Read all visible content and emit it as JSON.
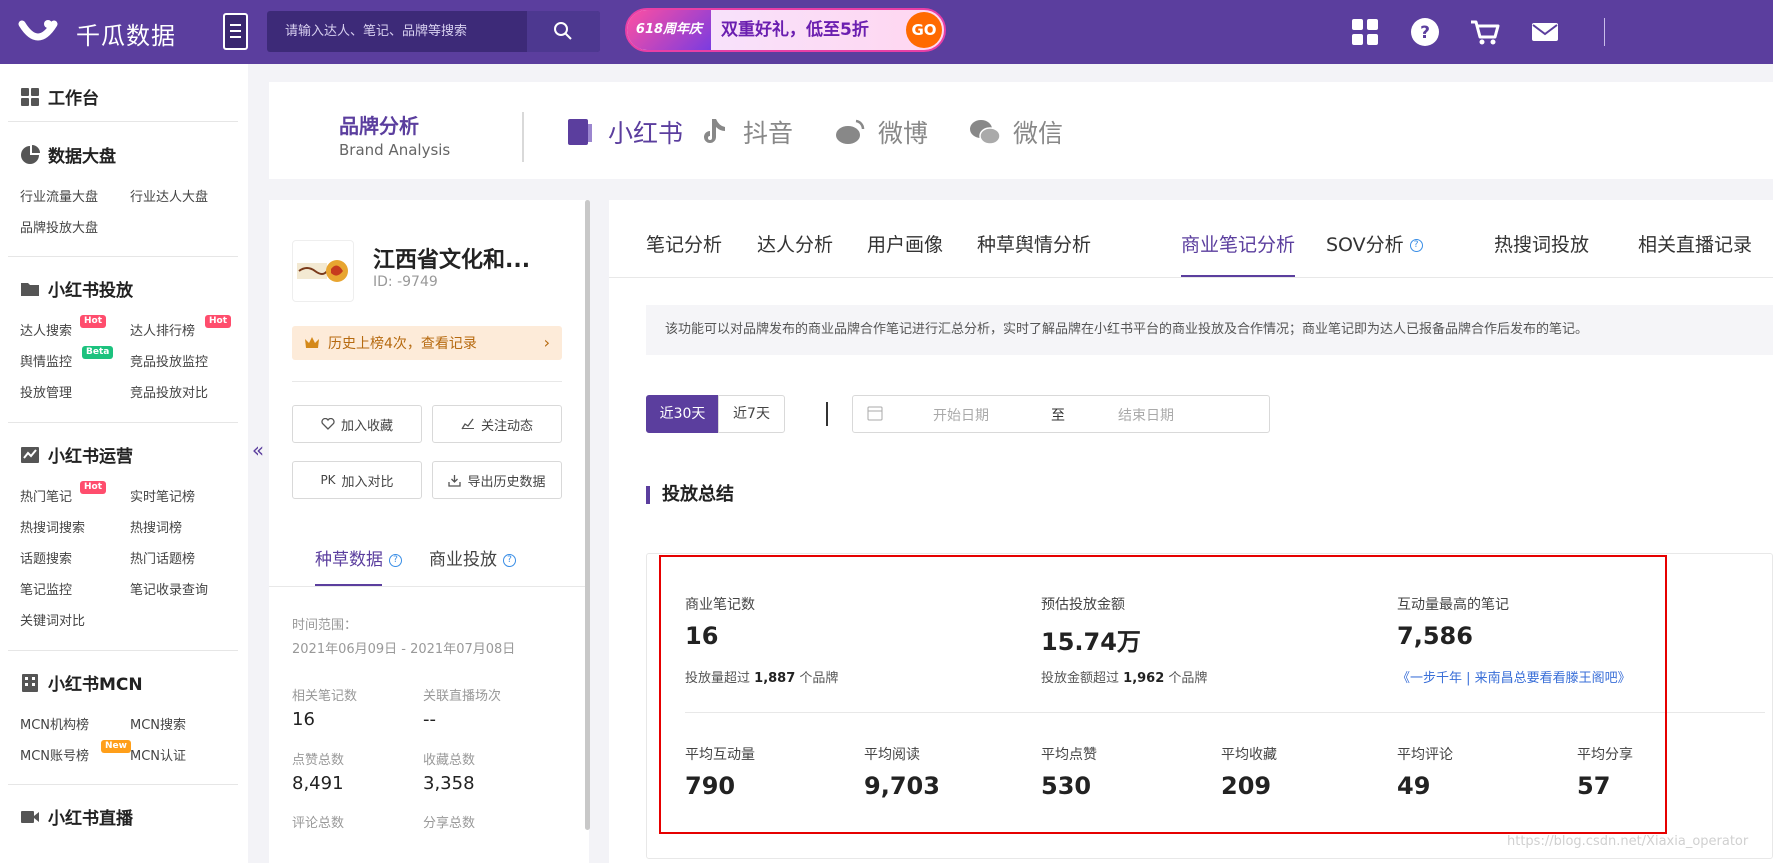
{
  "header": {
    "logo_text": "千瓜数据",
    "search_placeholder": "请输入达人、笔记、品牌等搜索",
    "promo": {
      "tag": "618周年庆",
      "text": "双重好礼，低至5折",
      "go": "GO"
    },
    "icons": [
      "grid-icon",
      "help-icon",
      "cart-icon",
      "mail-icon"
    ]
  },
  "sidebar": {
    "workbench": "工作台",
    "dashboard": {
      "title": "数据大盘",
      "links": [
        "行业流量大盘",
        "行业达人大盘",
        "品牌投放大盘"
      ]
    },
    "placement": {
      "title": "小红书投放",
      "links": [
        "达人搜索",
        "达人排行榜",
        "舆情监控",
        "竞品投放监控",
        "投放管理",
        "竞品投放对比"
      ]
    },
    "operation": {
      "title": "小红书运营",
      "links": [
        "热门笔记",
        "实时笔记榜",
        "热搜词搜索",
        "热搜词榜",
        "话题搜索",
        "热门话题榜",
        "笔记监控",
        "笔记收录查询",
        "关键词对比"
      ]
    },
    "mcn": {
      "title": "小红书MCN",
      "links": [
        "MCN机构榜",
        "MCN搜索",
        "MCN账号榜",
        "MCN认证"
      ]
    },
    "live": {
      "title": "小红书直播"
    },
    "badges": {
      "hot": "Hot",
      "beta": "Beta",
      "new": "New"
    },
    "collapse": "«"
  },
  "brand_bar": {
    "title": "品牌分析",
    "subtitle": "Brand Analysis",
    "platforms": [
      "小红书",
      "抖音",
      "微博",
      "微信"
    ]
  },
  "brand_panel": {
    "name": "江西省文化和...",
    "id": "ID: -9749",
    "history": "历史上榜4次，查看记录",
    "buttons": {
      "favorite": "加入收藏",
      "follow": "关注动态",
      "compare_prefix": "PK",
      "compare": "加入对比",
      "export": "导出历史数据"
    },
    "tabs": [
      "种草数据",
      "商业投放"
    ],
    "time_label": "时间范围：",
    "time_range": "2021年06月09日 - 2021年07月08日",
    "stats": [
      {
        "label": "相关笔记数",
        "value": "16"
      },
      {
        "label": "关联直播场次",
        "value": "--"
      },
      {
        "label": "点赞总数",
        "value": "8,491"
      },
      {
        "label": "收藏总数",
        "value": "3,358"
      },
      {
        "label": "评论总数",
        "value": ""
      },
      {
        "label": "分享总数",
        "value": ""
      }
    ]
  },
  "main": {
    "tabs": [
      "笔记分析",
      "达人分析",
      "用户画像",
      "种草舆情分析",
      "商业笔记分析",
      "SOV分析",
      "热搜词投放",
      "相关直播记录"
    ],
    "active_tab": "商业笔记分析",
    "notice": "该功能可以对品牌发布的商业品牌合作笔记进行汇总分析，实时了解品牌在小红书平台的商业投放及合作情况；商业笔记即为达人已报备品牌合作后发布的笔记。",
    "ranges": [
      "近30天",
      "近7天"
    ],
    "date_start_placeholder": "开始日期",
    "date_to": "至",
    "date_end_placeholder": "结束日期",
    "section_title": "投放总结",
    "summary_top": [
      {
        "label": "商业笔记数",
        "value": "16",
        "sub_prefix": "投放量超过",
        "sub_number": "1,887",
        "sub_suffix": "个品牌"
      },
      {
        "label": "预估投放金额",
        "value": "15.74万",
        "sub_prefix": "投放金额超过",
        "sub_number": "1,962",
        "sub_suffix": "个品牌"
      },
      {
        "label": "互动量最高的笔记",
        "value": "7,586",
        "link": "《一步千年 | 来南昌总要看看滕王阁吧》"
      }
    ],
    "summary_bottom": [
      {
        "label": "平均互动量",
        "value": "790"
      },
      {
        "label": "平均阅读",
        "value": "9,703"
      },
      {
        "label": "平均点赞",
        "value": "530"
      },
      {
        "label": "平均收藏",
        "value": "209"
      },
      {
        "label": "平均评论",
        "value": "49"
      },
      {
        "label": "平均分享",
        "value": "57"
      }
    ]
  },
  "watermark": "https://blog.csdn.net/Xiaxia_operator",
  "colors": {
    "brand": "#5b3e9e",
    "highlight_border": "#e60000",
    "hot": "#ff4d6d",
    "beta": "#1cc27e",
    "new": "#ff9f1a"
  }
}
